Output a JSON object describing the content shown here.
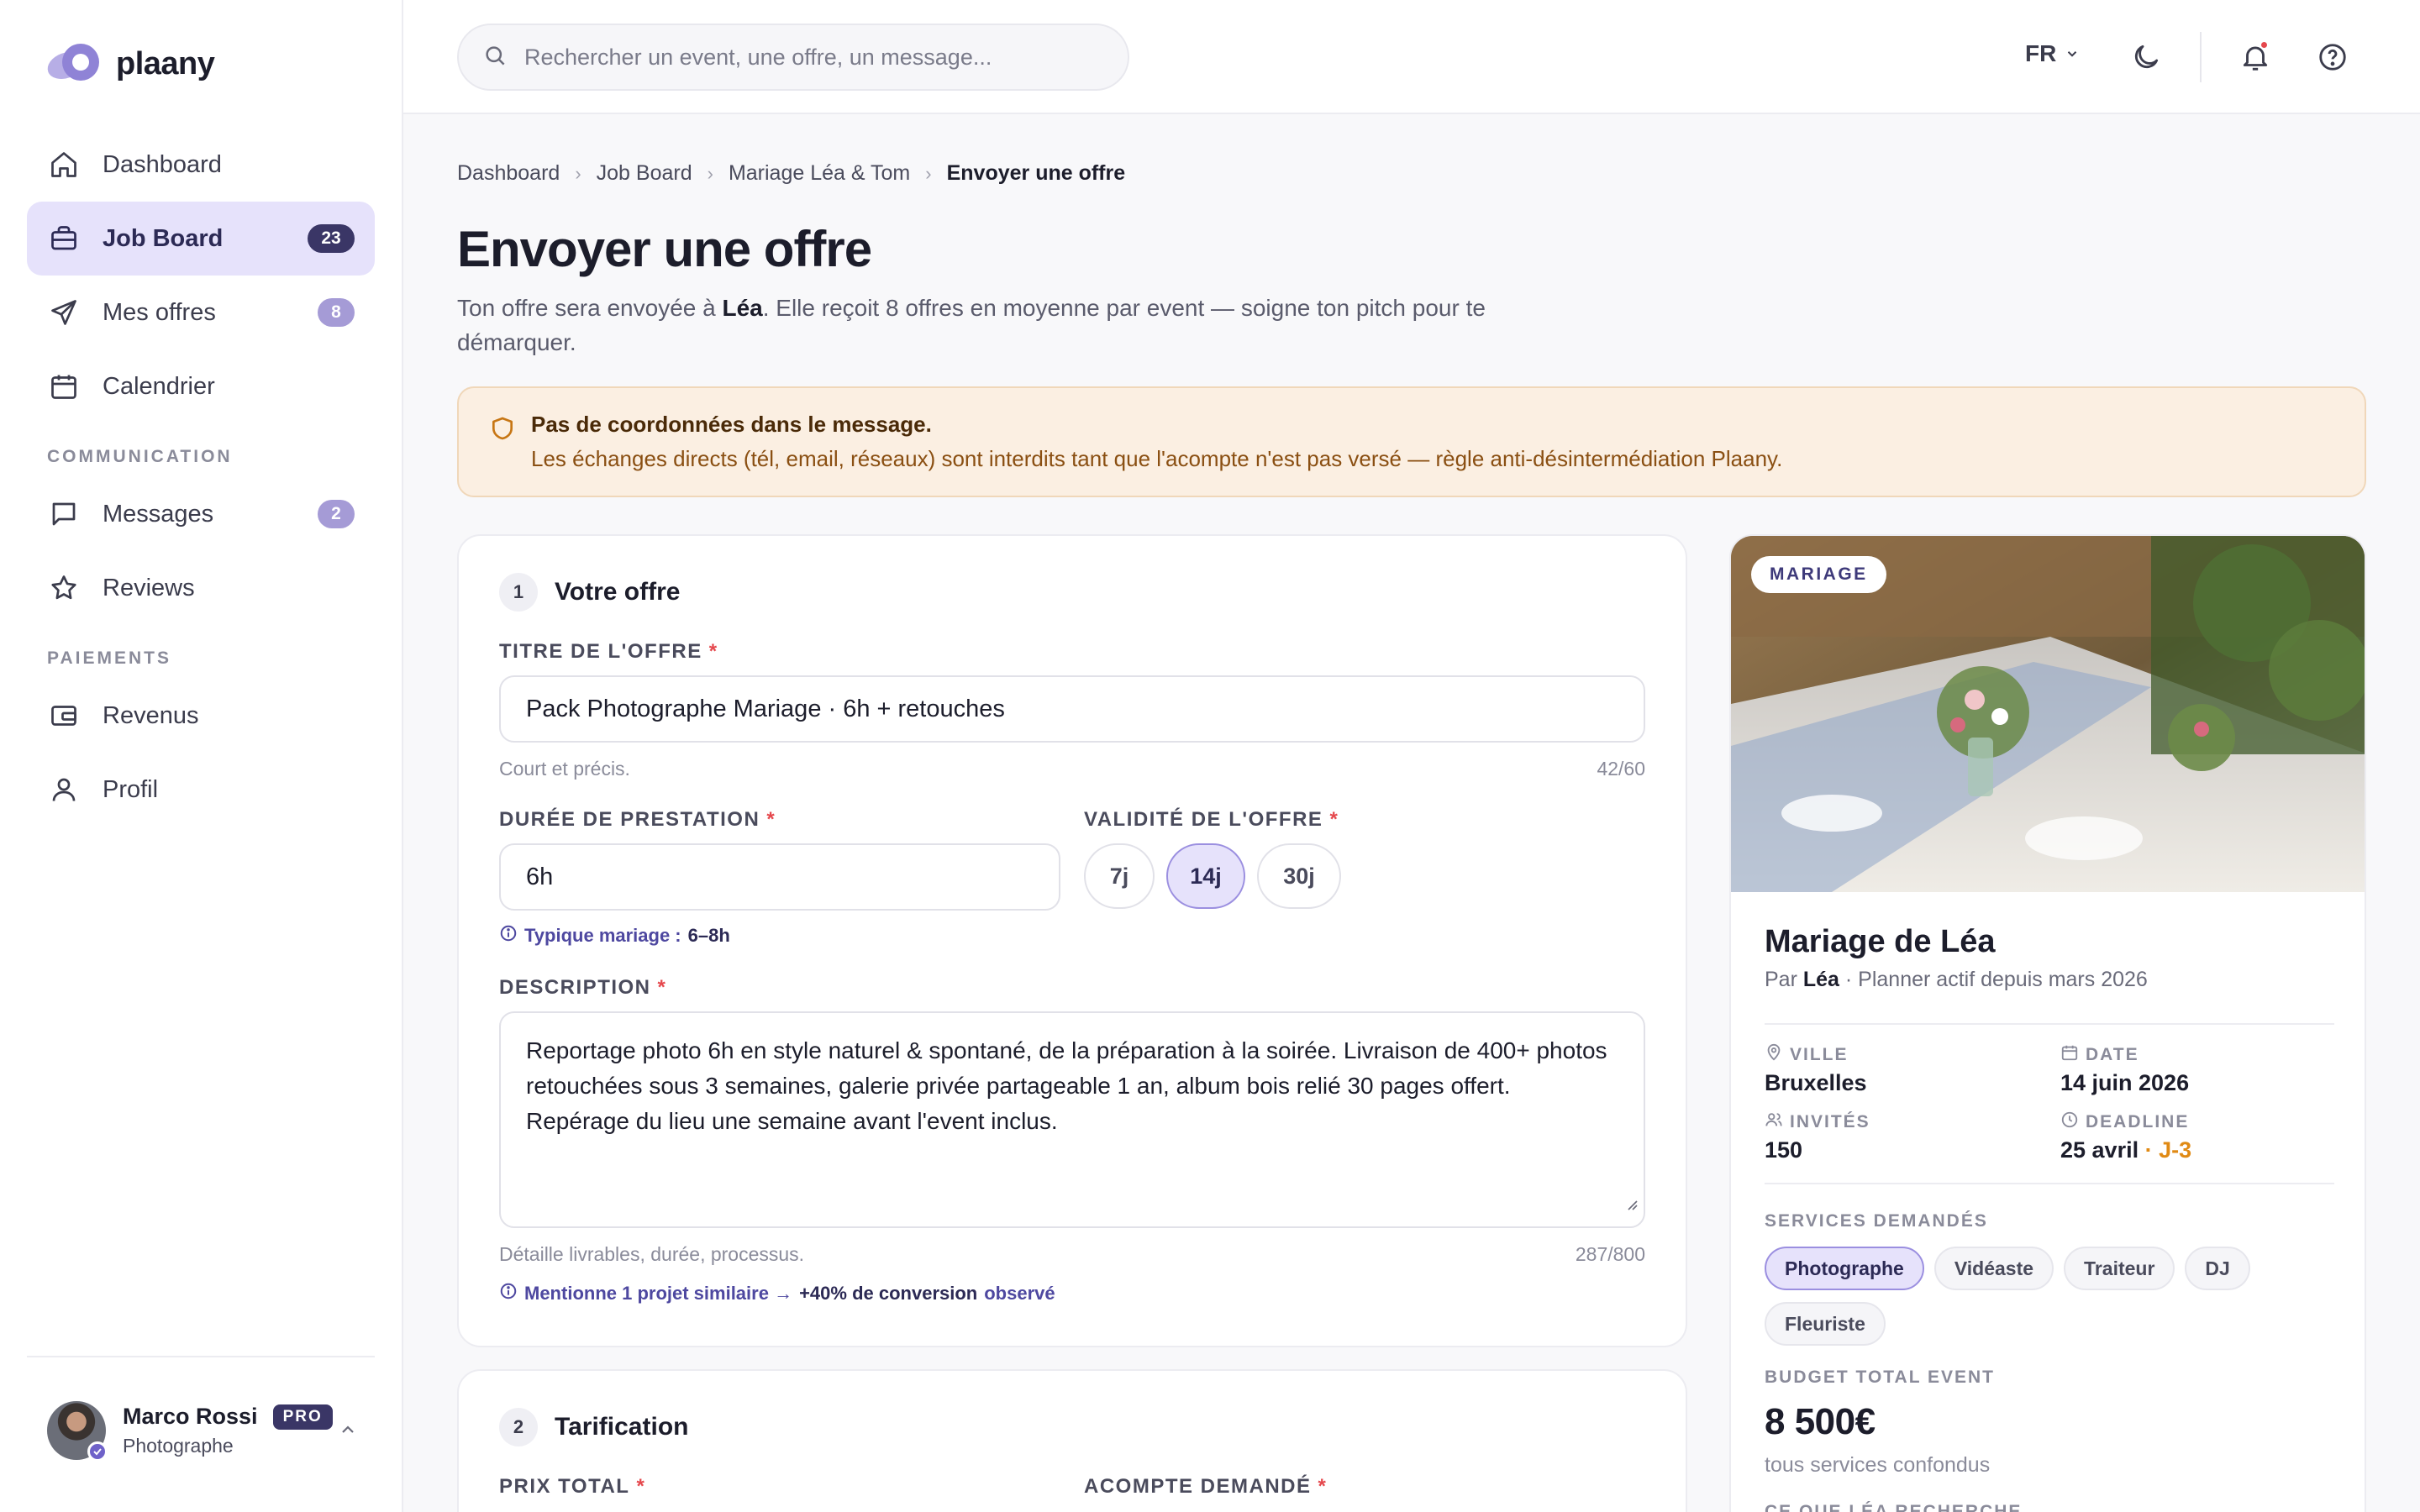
{
  "app": {
    "name": "plaany"
  },
  "sidebar": {
    "items": [
      {
        "label": "Dashboard",
        "icon": "home-icon"
      },
      {
        "label": "Job Board",
        "icon": "briefcase-icon",
        "badge": "23",
        "active": true
      },
      {
        "label": "Mes offres",
        "icon": "send-icon",
        "badge": "8"
      },
      {
        "label": "Calendrier",
        "icon": "calendar-icon"
      }
    ],
    "section_communication": "COMMUNICATION",
    "communication_items": [
      {
        "label": "Messages",
        "icon": "chat-icon",
        "badge": "2"
      },
      {
        "label": "Reviews",
        "icon": "star-icon"
      }
    ],
    "section_payments": "PAIEMENTS",
    "payment_items": [
      {
        "label": "Revenus",
        "icon": "wallet-icon"
      },
      {
        "label": "Profil",
        "icon": "user-icon"
      }
    ],
    "user": {
      "name": "Marco Rossi",
      "badge": "PRO",
      "role": "Photographe"
    }
  },
  "topbar": {
    "search_placeholder": "Rechercher un event, une offre, un message...",
    "language": "FR"
  },
  "breadcrumb": [
    "Dashboard",
    "Job Board",
    "Mariage Léa & Tom",
    "Envoyer une offre"
  ],
  "page": {
    "title": "Envoyer une offre",
    "subtitle_pre": "Ton offre sera envoyée à ",
    "subtitle_name": "Léa",
    "subtitle_post": ". Elle reçoit 8 offres en moyenne par event — soigne ton pitch pour te démarquer."
  },
  "alert": {
    "title": "Pas de coordonnées dans le message.",
    "text": "Les échanges directs (tél, email, réseaux) sont interdits tant que l'acompte n'est pas versé — règle anti-désintermédiation Plaany."
  },
  "offer": {
    "step_num": "1",
    "step_title": "Votre offre",
    "title_label": "TITRE DE L'OFFRE",
    "title_value": "Pack Photographe Mariage · 6h + retouches",
    "title_helper": "Court et précis.",
    "title_counter": "42/60",
    "duration_label": "DURÉE DE PRESTATION",
    "duration_value": "6h",
    "duration_tip_pre": "Typique mariage :",
    "duration_tip_value": "6–8h",
    "validity_label": "VALIDITÉ DE L'OFFRE",
    "validity_options": [
      "7j",
      "14j",
      "30j"
    ],
    "validity_selected": "14j",
    "desc_label": "DESCRIPTION",
    "desc_value": "Reportage photo 6h en style naturel & spontané, de la préparation à la soirée. Livraison de 400+ photos retouchées sous 3 semaines, galerie privée partageable 1 an, album bois relié 30 pages offert. Repérage du lieu une semaine avant l'event inclus.",
    "desc_helper": "Détaille livrables, durée, processus.",
    "desc_counter": "287/800",
    "desc_tip_pre": "Mentionne 1 projet similaire →",
    "desc_tip_bold": "+40% de conversion",
    "desc_tip_post": "observé"
  },
  "pricing": {
    "step_num": "2",
    "step_title": "Tarification",
    "price_label": "PRIX TOTAL",
    "deposit_label": "ACOMPTE DEMANDÉ"
  },
  "event": {
    "tag": "MARIAGE",
    "title": "Mariage de Léa",
    "by_pre": "Par ",
    "by_name": "Léa",
    "by_post": " · Planner actif depuis mars 2026",
    "city_label": "VILLE",
    "city": "Bruxelles",
    "date_label": "DATE",
    "date": "14 juin 2026",
    "guests_label": "INVITÉS",
    "guests": "150",
    "deadline_label": "DEADLINE",
    "deadline": "25 avril",
    "deadline_urgency": " · J-3",
    "services_label": "SERVICES DEMANDÉS",
    "services": [
      "Photographe",
      "Vidéaste",
      "Traiteur",
      "DJ",
      "Fleuriste"
    ],
    "services_selected": "Photographe",
    "budget_label": "BUDGET TOTAL EVENT",
    "budget": "8 500€",
    "budget_sub": "tous services confondus",
    "looking_label": "CE QUE LÉA RECHERCHE"
  },
  "colors": {
    "accent": "#e6e2fb",
    "accent_dark": "#3a3666",
    "warning_bg": "#fbefe2",
    "urgent": "#e08a14"
  }
}
